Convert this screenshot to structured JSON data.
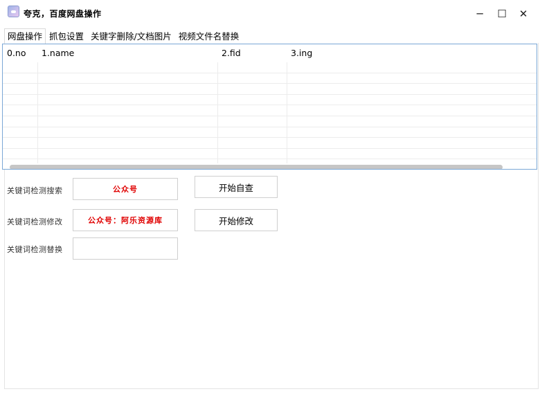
{
  "window": {
    "title": "夸克，百度网盘操作",
    "app_icon": "app-logo-icon",
    "controls": {
      "minimize": "─",
      "maximize": "☐",
      "close": "✕"
    }
  },
  "tabs": [
    {
      "label": "网盘操作",
      "active": true
    },
    {
      "label": "抓包设置",
      "active": false
    },
    {
      "label": "关键字删除/文档图片",
      "active": false
    },
    {
      "label": "视频文件名替换",
      "active": false
    }
  ],
  "table": {
    "columns": [
      "0.no",
      "1.name",
      "2.fid",
      "3.ing"
    ],
    "rows": []
  },
  "form": {
    "search_label": "关键词检测搜索",
    "search_value": "公众号",
    "modify_label": "关键词检测修改",
    "modify_value": "公众号：阿乐资源库",
    "replace_label": "关键词检测替换",
    "replace_value": "",
    "start_check_button": "开始自查",
    "start_modify_button": "开始修改",
    "value_color": "#e00000"
  }
}
